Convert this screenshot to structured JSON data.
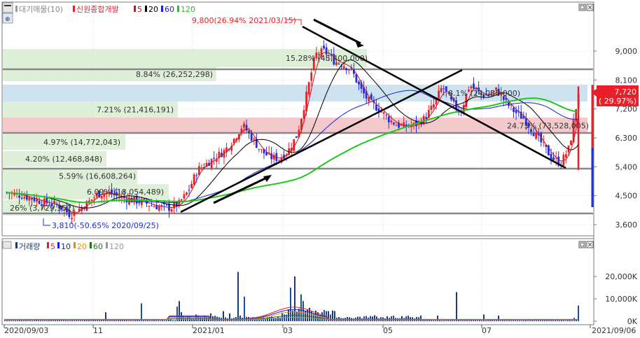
{
  "top_panel": {
    "legend": {
      "index_label": "대기매물(10)",
      "stock_label": "신원종합개발",
      "ma_5": "5",
      "ma_20": "20",
      "ma_60": "60",
      "ma_120": "120"
    },
    "price_axis": [
      "9,000",
      "8,100",
      "7,200",
      "6,300",
      "5,400",
      "4,500",
      "3,600"
    ],
    "high_annotation": "9,800(26.94% 2021/03/15)",
    "low_annotation": "3,810(-50.65% 2020/09/25)",
    "current_price": "7,720",
    "current_change": "( 29.97%)",
    "volume_profile_labels": [
      "15.28% (45,400,000)",
      "8.84% (26,252,298)",
      "7.21% (21,416,191)",
      "4.97% (14,772,043)",
      "4.20% (12,468,848)",
      "5.59% (16,608,264)",
      "6.09% (18,054,489)",
      "26% (3,729,352)",
      "24.75% (73,528,005)",
      "8.1% (24,080,000)"
    ]
  },
  "bottom_panel": {
    "legend": {
      "label": "거래량",
      "ma_5": "5",
      "ma_10": "10",
      "ma_20": "20",
      "ma_60": "60",
      "ma_120": "120"
    },
    "volume_axis": [
      "20,000K",
      "10,000K",
      "0K"
    ]
  },
  "x_axis": {
    "dates": [
      "2020/09/03",
      "11",
      "2021/01",
      "03",
      "05",
      "07",
      "2021/09/06"
    ]
  },
  "colors": {
    "up": "#e8202a",
    "down": "#1e2ee0",
    "ma5": "#c8161e",
    "ma20": "#000000",
    "ma60": "#1a22cc",
    "ma120": "#1ec81e",
    "profile_green": "#dff0d8",
    "profile_blue": "#cfe2f0",
    "profile_red": "#f4c9cc"
  },
  "chart_data": {
    "type": "candlestick",
    "title": "신원종합개발",
    "x_range": [
      "2020/09/03",
      "2021/09/06"
    ],
    "ylim": [
      3400,
      10000
    ],
    "y_ticks": [
      9000,
      8100,
      7200,
      6300,
      5400,
      4500,
      3600
    ],
    "series_close": [
      4600,
      4550,
      4480,
      4400,
      4300,
      4250,
      4150,
      3900,
      4100,
      4300,
      4550,
      4600,
      4500,
      4420,
      4350,
      4300,
      4200,
      4150,
      4120,
      4250,
      4650,
      5300,
      5500,
      5700,
      5900,
      6250,
      6700,
      6300,
      5900,
      5700,
      5650,
      5900,
      6400,
      7600,
      8900,
      9000,
      8700,
      8600,
      8400,
      7800,
      7400,
      7200,
      6900,
      6700,
      6650,
      6700,
      6900,
      7300,
      7900,
      7400,
      7100,
      7950,
      7700,
      7600,
      7800,
      7400,
      7100,
      6900,
      6500,
      6100,
      5700,
      5500,
      6000,
      7720
    ],
    "highest": {
      "value": 9800,
      "label": "9,800(26.94% 2021/03/15)"
    },
    "lowest": {
      "value": 3810,
      "label": "3,810(-50.65% 2020/09/25)"
    },
    "last": {
      "value": 7720,
      "change": "29.97%"
    },
    "moving_averages": [
      "5",
      "20",
      "60",
      "120"
    ],
    "horizontal_levels": [
      8500,
      6300,
      5400,
      3900
    ],
    "volume": {
      "unit": "K",
      "ylim": [
        0,
        30000
      ],
      "ticks": [
        20000,
        10000,
        0
      ]
    }
  }
}
